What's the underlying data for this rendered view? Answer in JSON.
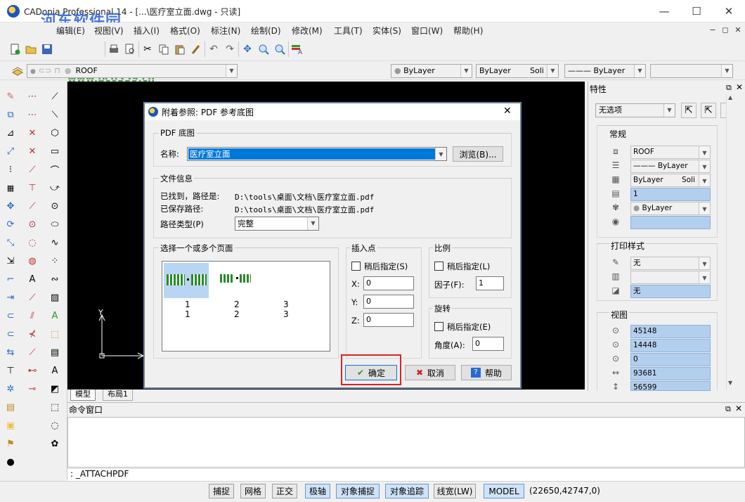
{
  "window": {
    "title": "CADopia Professional 14 - [...\\医疗室立面.dwg - 只读]",
    "watermark": "河东软件园",
    "watermark_url": "www.pc0359.cn",
    "min_glyph": "—",
    "max_glyph": "☐",
    "close_glyph": "✕"
  },
  "menu": [
    "编辑(E)",
    "视图(V)",
    "插入(I)",
    "格式(O)",
    "标注(N)",
    "绘制(D)",
    "修改(M)",
    "工具(T)",
    "实体(S)",
    "窗口(W)",
    "帮助(H)"
  ],
  "mdi": [
    "−",
    "◻",
    "✕"
  ],
  "layer_bar": {
    "layer": "ROOF",
    "color": "ByLayer",
    "linetype": "ByLayer",
    "linetype_right": "Soli",
    "lineweight": "——— ByLayer",
    "plotstyle": ""
  },
  "tabs": {
    "model": "模型",
    "layout": "布局1"
  },
  "dialog": {
    "title": "附着参照: PDF 参考底图",
    "close": "✕",
    "pdf_group": "PDF 底图",
    "name_label": "名称:",
    "name_value": "医疗室立面",
    "browse": "浏览(B)...",
    "file_group": "文件信息",
    "found_label": "已找到，路径是:",
    "found_value": "D:\\tools\\桌面\\文档\\医疗室立面.pdf",
    "saved_label": "已保存路径:",
    "saved_value": "D:\\tools\\桌面\\文档\\医疗室立面.pdf",
    "pathtype_label": "路径类型(P)",
    "pathtype_value": "完整",
    "pages_group": "选择一个或多个页面",
    "page_nums_row1": [
      "1",
      "2",
      "3"
    ],
    "page_nums_row2": [
      "1",
      "2",
      "3"
    ],
    "insert_group": "插入点",
    "insert_specify": "稍后指定(S)",
    "x_label": "X:",
    "x_value": "0",
    "y_label": "Y:",
    "y_value": "0",
    "z_label": "Z:",
    "z_value": "0",
    "scale_group": "比例",
    "scale_specify": "稍后指定(L)",
    "factor_label": "因子(F):",
    "factor_value": "1",
    "rotate_group": "旋转",
    "rotate_specify": "稍后指定(E)",
    "angle_label": "角度(A):",
    "angle_value": "0",
    "ok": "确定",
    "cancel": "取消",
    "help": "帮助",
    "ok_icon": "✔",
    "cancel_icon": "✖",
    "help_icon": "?"
  },
  "properties": {
    "title": "特性",
    "selection": "无选项",
    "general": "常规",
    "layer": "ROOF",
    "color": "——— ByLayer",
    "linetype": "ByLayer",
    "linetype_right": "Soli",
    "scale": "1",
    "lineweight": "ByLayer",
    "plot_group": "打印样式",
    "plot1": "无",
    "plot2": "",
    "plot3": "无",
    "view_group": "视图",
    "view_values": [
      "45148",
      "14448",
      "0",
      "93681",
      "56599"
    ]
  },
  "command": {
    "title": "命令窗口",
    "line": ": _ATTACHPDF"
  },
  "status": {
    "buttons": [
      "捕捉",
      "网格",
      "正交",
      "极轴",
      "对象捕捉",
      "对象追踪",
      "线宽(LW)",
      "MODEL"
    ],
    "coords": "(22650,42747,0)"
  },
  "ucs": {
    "y": "Y"
  }
}
